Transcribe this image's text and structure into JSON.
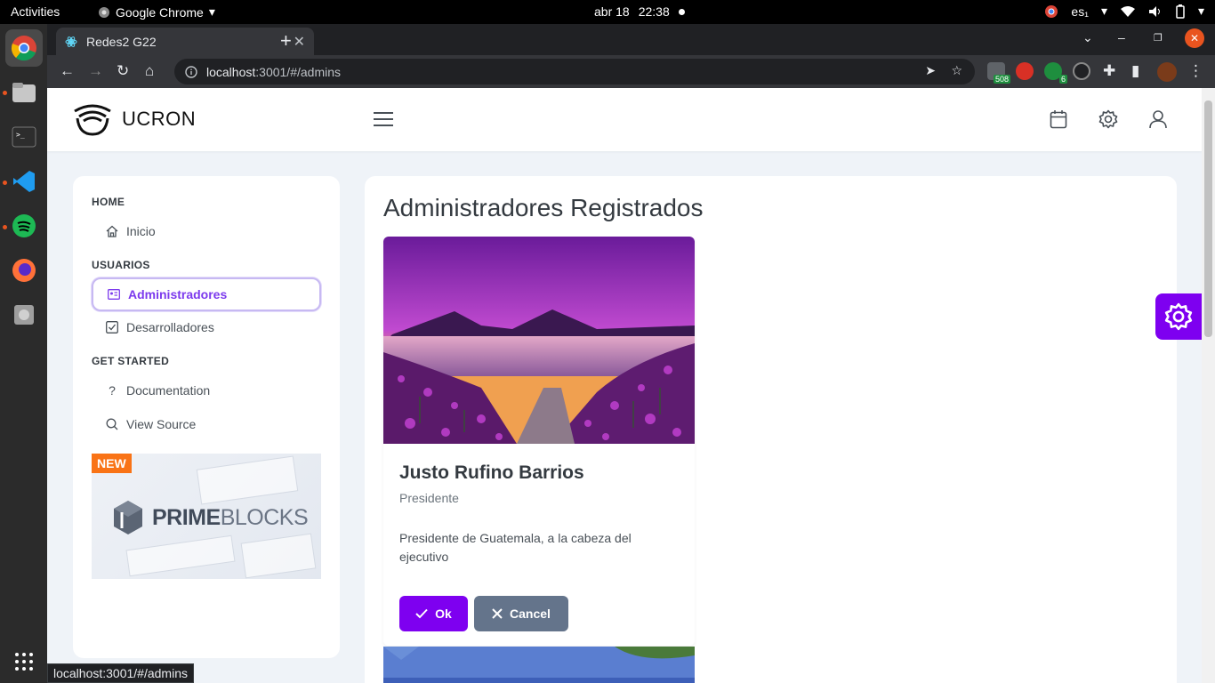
{
  "topbar": {
    "activities": "Activities",
    "app": "Google Chrome",
    "date": "abr 18",
    "time": "22:38",
    "lang": "es₁"
  },
  "dock": {
    "items": [
      "chrome-icon",
      "files-icon",
      "terminal-icon",
      "vscode-icon",
      "spotify-icon",
      "firefox-icon",
      "disk-icon",
      "app-grid-icon"
    ]
  },
  "browser": {
    "tab_title": "Redes2 G22",
    "url_host": "localhost",
    "url_rest": ":3001/#/admins",
    "ext_badge_1": "508",
    "ext_badge_2": "6",
    "status_url": "localhost:3001/#/admins"
  },
  "app": {
    "brand": "UCRON",
    "sidebar": {
      "sections": [
        {
          "title": "HOME",
          "items": [
            {
              "label": "Inicio",
              "icon": "home-icon"
            }
          ]
        },
        {
          "title": "USUARIOS",
          "items": [
            {
              "label": "Administradores",
              "icon": "id-card-icon",
              "active": true
            },
            {
              "label": "Desarrolladores",
              "icon": "check-square-icon"
            }
          ]
        },
        {
          "title": "GET STARTED",
          "items": [
            {
              "label": "Documentation",
              "icon": "question-icon"
            },
            {
              "label": "View Source",
              "icon": "search-icon"
            }
          ]
        }
      ],
      "promo": {
        "badge": "NEW",
        "brand_a": "PRIME",
        "brand_b": "BLOCKS"
      }
    },
    "main": {
      "title": "Administradores Registrados",
      "card": {
        "name": "Justo Rufino Barrios",
        "subtitle": "Presidente",
        "description": "Presidente de Guatemala, a la cabeza del ejecutivo",
        "ok_label": "Ok",
        "cancel_label": "Cancel"
      }
    },
    "colors": {
      "accent": "#7e00f0",
      "cancel": "#64748b"
    }
  }
}
